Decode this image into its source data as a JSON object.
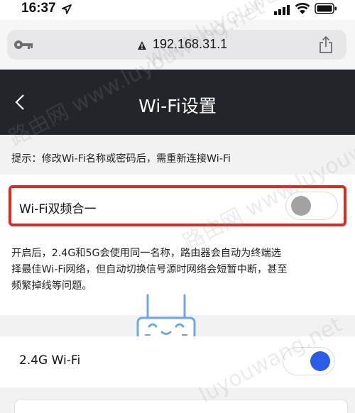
{
  "status_bar": {
    "time": "16:37"
  },
  "browser": {
    "url": "192.168.31.1"
  },
  "header": {
    "title": "Wi-Fi设置"
  },
  "hint": {
    "text": "提示：修改Wi-Fi名称或密码后，需重新连接Wi-Fi"
  },
  "dual_band": {
    "label": "Wi-Fi双频合一",
    "enabled": false,
    "description_lines": [
      "开启后，2.4G和5G会使用同一名称，路由器会自动为终端选",
      "择最佳Wi-Fi网络，但自动切换信号源时网络会短暂中断，甚至",
      "频繁掉线等问题。"
    ]
  },
  "wifi_24": {
    "label": "2.4G Wi-Fi",
    "enabled": true
  },
  "colors": {
    "header_bg": "#23252b",
    "highlight_border": "#e0291f",
    "toggle_on": "#2b5ce6",
    "toggle_off_knob": "#a3a3a3",
    "section_bg": "#f2f2f2"
  },
  "watermarks": [
    "路由网 www.luyouwang.net",
    "www.luyouwang.net",
    "路由网 www.luyouwang.net",
    "luyouwang.net"
  ],
  "icons": [
    "location-arrow-icon",
    "signal-icon",
    "wifi-icon",
    "battery-icon",
    "key-icon",
    "lock-icon",
    "share-icon",
    "back-icon",
    "router-icon"
  ]
}
